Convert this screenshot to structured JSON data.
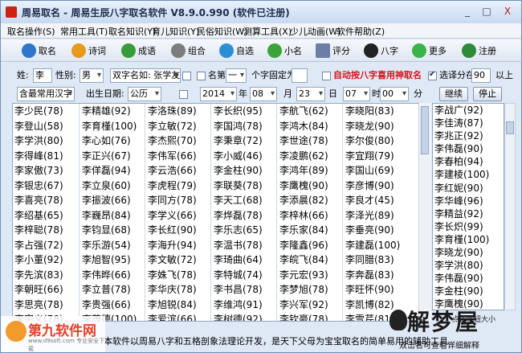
{
  "window": {
    "title": "周易取名 - 周易生辰八字取名软件 V8.9.0.990 (软件已注册)",
    "controls": [
      "_",
      "□",
      "X"
    ]
  },
  "menu": [
    "取名操作(S)",
    "常用工具(T)",
    "取名知识(Y)",
    "育儿知识(Y)",
    "民俗知识(W)",
    "测算工具(X)",
    "少儿动画(W)",
    "软件帮助(Z)"
  ],
  "toolbar": [
    {
      "label": "取名",
      "icon": "name-icon",
      "color": "#2d76c9"
    },
    {
      "label": "诗词",
      "icon": "up-arrow-icon",
      "color": "#e69a1e"
    },
    {
      "label": "成语",
      "icon": "dice-icon",
      "color": "#3a9b3a"
    },
    {
      "label": "组合",
      "icon": "gears-icon",
      "color": "#7d7d7d"
    },
    {
      "label": "自选",
      "icon": "globe-icon",
      "color": "#2b8ed6"
    },
    {
      "label": "小名",
      "icon": "chat-icon",
      "color": "#3aa33a"
    },
    {
      "label": "评分",
      "icon": "document-icon",
      "color": "#6a7fa3"
    },
    {
      "label": "八字",
      "icon": "yinyang-icon",
      "color": "#222222"
    },
    {
      "label": "更多",
      "icon": "plus-icon",
      "color": "#3bb34a"
    },
    {
      "label": "注册",
      "icon": "user-icon",
      "color": "#2e8b3a"
    }
  ],
  "form": {
    "surname_label": "姓:",
    "surname_value": "李",
    "gender_label": "性别:",
    "gender_value": "男",
    "double_name_value": "双字名如: 张学友",
    "name_label": "名第",
    "name_pos_value": "一",
    "fixed_char_label": "个字固定为",
    "auto_bazi_label": "自动按八字喜用神取名",
    "score_label": "选译分在",
    "score_value": "90",
    "score_suffix": "以上",
    "charset_value": "含最常用汉字",
    "birth_label": "出生日期:",
    "calendar_value": "公历",
    "year_value": "2014",
    "year_label": "年",
    "month_value": "08",
    "month_label": "月",
    "day_value": "23",
    "day_label": "日",
    "hour_value": "07",
    "hour_label": "时",
    "minute_value": "00",
    "minute_label": "分",
    "continue_button": "继续",
    "stop_button": "停止"
  },
  "names_grid": [
    [
      "李少民(78)",
      "李登山(58)",
      "李学洪(80)",
      "李得峰(81)",
      "李家傲(73)",
      "李银忠(67)",
      "李喜亮(78)",
      "李绍基(65)",
      "李梓聪(78)",
      "李占强(72)",
      "李小董(92)",
      "李先滨(83)",
      "李朝旺(66)",
      "李思亮(78)",
      "李宗义(78)",
      "李思翀(79)",
      "李景生(68)"
    ],
    [
      "李精雄(92)",
      "李育槿(100)",
      "李心如(76)",
      "李正兴(67)",
      "李佯磊(94)",
      "李立泉(60)",
      "李振波(66)",
      "李巍昂(84)",
      "李钧显(68)",
      "李乐游(54)",
      "李旭智(95)",
      "李伟晔(66)",
      "李立普(78)",
      "李贵强(66)",
      "李茂德(100)",
      "李创植(82)",
      "李思淳(66)"
    ],
    [
      "李洛珠(89)",
      "李立敏(72)",
      "李杰熙(70)",
      "李伟军(66)",
      "李云浩(66)",
      "李虎程(79)",
      "李同方(78)",
      "李学义(66)",
      "李长红(90)",
      "李海升(94)",
      "李文敏(72)",
      "李姝飞(78)",
      "李华庆(78)",
      "李旭锐(84)",
      "李爱滨(66)",
      "李奋强(59)",
      "李国宏(92)"
    ],
    [
      "李长织(95)",
      "李国鸿(78)",
      "李秉章(72)",
      "李小威(46)",
      "李金柱(90)",
      "李联葵(78)",
      "李天工(68)",
      "李烨磊(78)",
      "李乐志(65)",
      "李温书(78)",
      "李琦曲(64)",
      "李特城(74)",
      "李书昌(78)",
      "李维鸿(91)",
      "李树德(92)",
      "李俊忠(60)"
    ],
    [
      "李航飞(62)",
      "李鸿木(84)",
      "李世途(78)",
      "李凌鹏(62)",
      "李鸿年(89)",
      "李鹰槐(90)",
      "李添晨(82)",
      "李梓林(66)",
      "李乐家(84)",
      "李隆鑫(96)",
      "李皖飞(84)",
      "李元宏(93)",
      "李梦旭(78)",
      "李兴军(92)",
      "李钦豪(78)",
      "李尤杰(96)"
    ],
    [
      "李晓阳(83)",
      "李晓龙(90)",
      "李尔俊(80)",
      "李宜翔(79)",
      "李国山(69)",
      "李彦博(90)",
      "李良才(45)",
      "李泽光(89)",
      "李垂亮(90)",
      "李建磊(100)",
      "李同腊(83)",
      "李奔磊(83)",
      "李旺怀(90)",
      "李凯博(82)",
      "李雪芹(81)",
      "李剑浩(68)"
    ]
  ],
  "right_list": [
    "李战广(92)",
    "李佳涛(87)",
    "李兆正(92)",
    "李伟磊(90)",
    "李春柏(94)",
    "李建棱(100)",
    "李红妮(90)",
    "李华峰(96)",
    "李精益(92)",
    "李长炽(99)",
    "李育槿(100)",
    "李晓龙(90)",
    "李学洪(80)",
    "李伟磊(90)",
    "李金柱(90)",
    "李鹰槐(90)"
  ],
  "status": {
    "text": "本软件以周易八字和五格剖象法理论开发，是天下父母为宝宝取名的简单易用的辅助工具。"
  },
  "watermark_left": {
    "brand": "第九软件网",
    "url": "www.d9soft.com 专业安全下载"
  },
  "watermark_right": {
    "brand": "解梦屋",
    "sub": "双击名可查看详细解释"
  },
  "right_bottom_button": "点击按钮大小"
}
